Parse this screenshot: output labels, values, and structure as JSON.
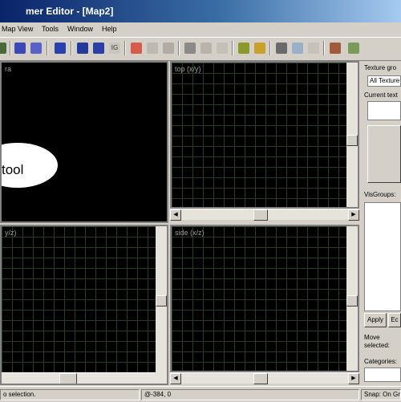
{
  "window": {
    "title": "mer Editor - [Map2]"
  },
  "menu": [
    "Map",
    "View",
    "Tools",
    "Window",
    "Help"
  ],
  "toolbar": {
    "icons": [
      "select-brush-icon",
      "select-face-icon",
      "select-vertex-icon",
      "cube-icon",
      "group-icon",
      "ungroup-icon",
      "texture-lock-icon",
      "camera-icon",
      "clip-icon",
      "carve-icon",
      "cut-icon",
      "copy-icon",
      "paste-icon",
      "grid-smaller-icon",
      "grid-larger-icon",
      "select-box-icon",
      "zoom-icon",
      "texture-apply-icon",
      "prefab-icon",
      "light-icon"
    ]
  },
  "viewports": {
    "camera": {
      "label": "ra",
      "overlay_text": "tool"
    },
    "top": {
      "label": "top (x/y)"
    },
    "front": {
      "label": "y/z)"
    },
    "side": {
      "label": "side (x/z)"
    }
  },
  "right_panel": {
    "texture_group_label": "Texture gro",
    "texture_group_value": "All Texture",
    "current_texture_label": "Current text",
    "visgroups_label": "VisGroups:",
    "apply_button": "Apply",
    "edit_button": "Ec",
    "move_selected": "Move selected:",
    "categories_label": "Categories:"
  },
  "status": {
    "message": "o selection.",
    "coords": "@-384, 0",
    "snap": "Snap: On Gr"
  }
}
